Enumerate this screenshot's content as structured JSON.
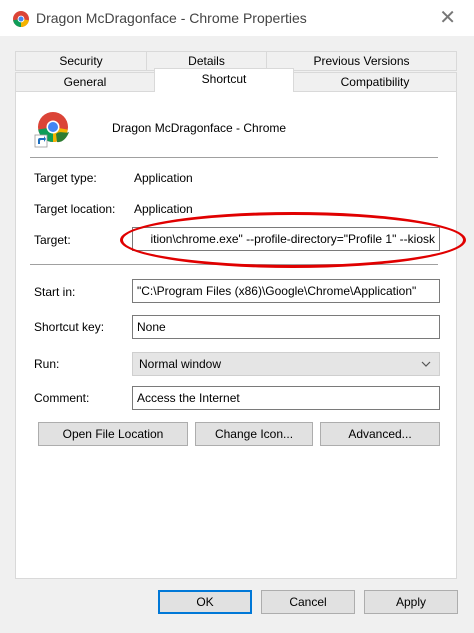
{
  "window": {
    "title": "Dragon McDragonface - Chrome Properties",
    "close_symbol": "✕"
  },
  "tabs": {
    "row1": [
      "Security",
      "Details",
      "Previous Versions"
    ],
    "row2": [
      "General",
      "Shortcut",
      "Compatibility"
    ],
    "active": "Shortcut"
  },
  "shortcut": {
    "app_name": "Dragon McDragonface - Chrome",
    "target_type_label": "Target type:",
    "target_type_value": "Application",
    "target_location_label": "Target location:",
    "target_location_value": "Application",
    "target_label": "Target:",
    "target_value": "ition\\chrome.exe\" --profile-directory=\"Profile 1\" --kiosk",
    "start_in_label": "Start in:",
    "start_in_value": "\"C:\\Program Files (x86)\\Google\\Chrome\\Application\"",
    "shortcut_key_label": "Shortcut key:",
    "shortcut_key_value": "None",
    "run_label": "Run:",
    "run_value": "Normal window",
    "comment_label": "Comment:",
    "comment_value": "Access the Internet",
    "open_file_location_label": "Open File Location",
    "change_icon_label": "Change Icon...",
    "advanced_label": "Advanced..."
  },
  "footer": {
    "ok_label": "OK",
    "cancel_label": "Cancel",
    "apply_label": "Apply"
  },
  "colors": {
    "highlight_ellipse": "#e00000",
    "default_button_border": "#0078d7"
  },
  "icons": [
    "chrome-dragon-icon",
    "shortcut-arrow-icon",
    "chevron-down-icon"
  ]
}
